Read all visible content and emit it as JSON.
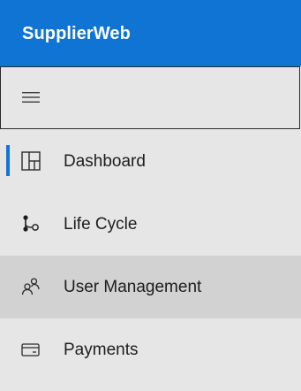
{
  "app": {
    "title": "SupplierWeb"
  },
  "menu": {
    "toggle_icon": "hamburger-icon"
  },
  "nav": {
    "items": [
      {
        "label": "Dashboard",
        "icon": "dashboard-icon",
        "active": true
      },
      {
        "label": "Life Cycle",
        "icon": "lifecycle-icon"
      },
      {
        "label": "User Management",
        "icon": "users-icon",
        "hovered": true
      },
      {
        "label": "Payments",
        "icon": "payment-card-icon"
      }
    ]
  },
  "colors": {
    "brand": "#0f74d3",
    "active_indicator": "#1473d6",
    "sidebar_bg": "#e6e6e6",
    "hover_bg": "#d2d2d2"
  }
}
